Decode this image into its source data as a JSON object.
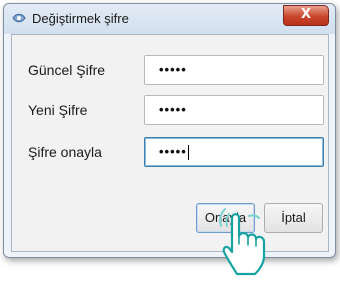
{
  "dialog": {
    "title": "Değiştirmek şifre",
    "close_label": "X"
  },
  "fields": [
    {
      "label": "Güncel Şifre",
      "value": "•••••"
    },
    {
      "label": "Yeni Şifre",
      "value": "•••••"
    },
    {
      "label": "Şifre onayla",
      "value": "•••••"
    }
  ],
  "buttons": {
    "confirm_label": "Onayla",
    "cancel_label": "İptal"
  },
  "colors": {
    "accent_focus": "#3c7fb1",
    "close_button": "#c9462c"
  },
  "icons": [
    "app-icon",
    "pointing-hand-icon"
  ]
}
